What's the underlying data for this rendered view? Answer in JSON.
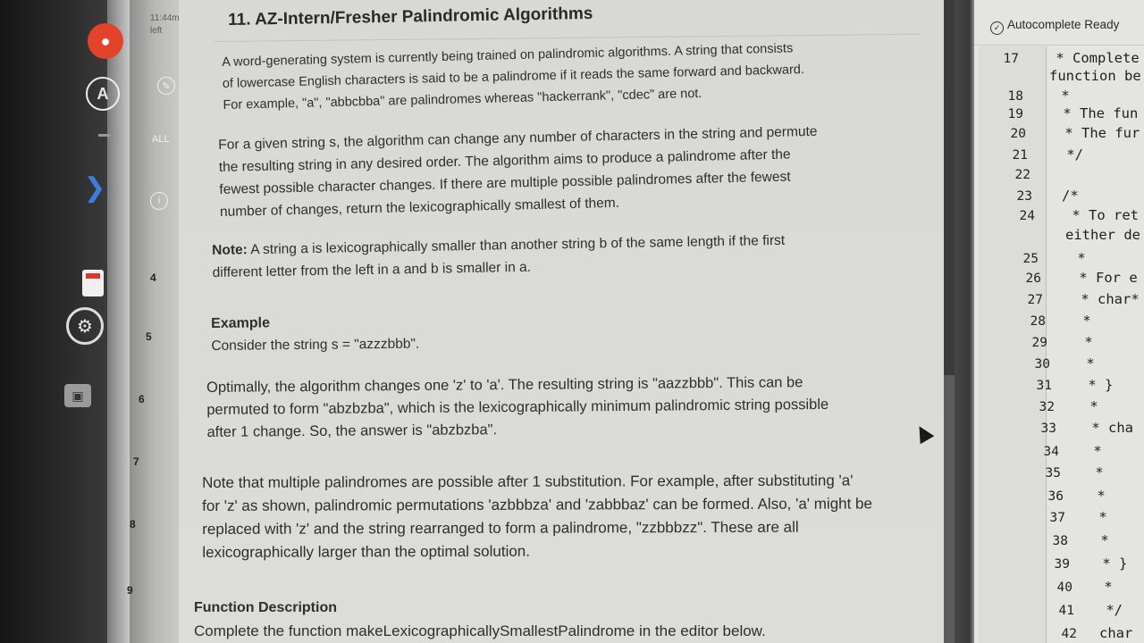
{
  "sidebar": {
    "time": "11:44m",
    "time_sub": "left",
    "filter_all": "ALL",
    "question_numbers": [
      "4",
      "5",
      "6",
      "7",
      "8",
      "9"
    ]
  },
  "problem": {
    "title": "11. AZ-Intern/Fresher Palindromic Algorithms",
    "intro": [
      "A word-generating system is currently being trained on palindromic algorithms. A string that consists",
      "of lowercase English characters is said to be a palindrome if it reads the same forward and backward.",
      "For example, \"a\", \"abbcbba\" are palindromes whereas \"hackerrank\", \"cdec\" are not."
    ],
    "task": [
      "For a given string s, the algorithm can change any number of characters in the string and permute",
      "the resulting string in any desired order. The algorithm aims to produce a palindrome after the",
      "fewest possible character changes. If there are multiple possible palindromes after the fewest",
      "number of changes, return the lexicographically smallest of them."
    ],
    "note_label": "Note:",
    "note": [
      "A string a is lexicographically smaller than another string b of the same length if the first",
      "different letter from the left in a and b is smaller in a."
    ],
    "example_heading": "Example",
    "example_line": "Consider the string s = \"azzzbbb\".",
    "explanation": [
      "Optimally, the algorithm changes one 'z' to 'a'. The resulting string is \"aazzbbb\". This can be",
      "permuted to form \"abzbzba\", which is the lexicographically minimum palindromic string possible",
      "after 1 change. So, the answer is \"abzbzba\"."
    ],
    "note2": [
      "Note that multiple palindromes are possible after 1 substitution. For example, after substituting 'a'",
      "for 'z' as shown, palindromic permutations 'azbbbza' and 'zabbbaz' can be formed. Also, 'a' might be",
      "replaced with 'z' and the string rearranged to form a palindrome, \"zzbbbzz\". These are all",
      "lexicographically larger than the optimal solution."
    ],
    "function_heading": "Function Description",
    "function_line": "Complete the function makeLexicographicallySmallestPalindrome in the editor below."
  },
  "editor": {
    "status": "Autocomplete Ready",
    "lines": [
      {
        "no": "17",
        "code": " * Complete"
      },
      {
        "no": "",
        "code": "function be"
      },
      {
        "no": "18",
        "code": " *"
      },
      {
        "no": "19",
        "code": " * The fun"
      },
      {
        "no": "20",
        "code": " * The fur"
      },
      {
        "no": "21",
        "code": " */"
      },
      {
        "no": "22",
        "code": ""
      },
      {
        "no": "23",
        "code": "/*"
      },
      {
        "no": "24",
        "code": " * To ret"
      },
      {
        "no": "",
        "code": "either de"
      },
      {
        "no": "25",
        "code": " *"
      },
      {
        "no": "26",
        "code": " * For e"
      },
      {
        "no": "27",
        "code": " * char*"
      },
      {
        "no": "28",
        "code": " *"
      },
      {
        "no": "29",
        "code": " *"
      },
      {
        "no": "30",
        "code": " *"
      },
      {
        "no": "31",
        "code": " * }"
      },
      {
        "no": "32",
        "code": " *"
      },
      {
        "no": "33",
        "code": " * cha"
      },
      {
        "no": "34",
        "code": " *"
      },
      {
        "no": "35",
        "code": " *"
      },
      {
        "no": "36",
        "code": " *"
      },
      {
        "no": "37",
        "code": " *"
      },
      {
        "no": "38",
        "code": " *"
      },
      {
        "no": "39",
        "code": " * }"
      },
      {
        "no": "40",
        "code": " *"
      },
      {
        "no": "41",
        "code": " */"
      },
      {
        "no": "42",
        "code": "char"
      }
    ]
  },
  "colors": {
    "accent_red": "#e3422b",
    "accent_blue": "#3d7bdc"
  }
}
